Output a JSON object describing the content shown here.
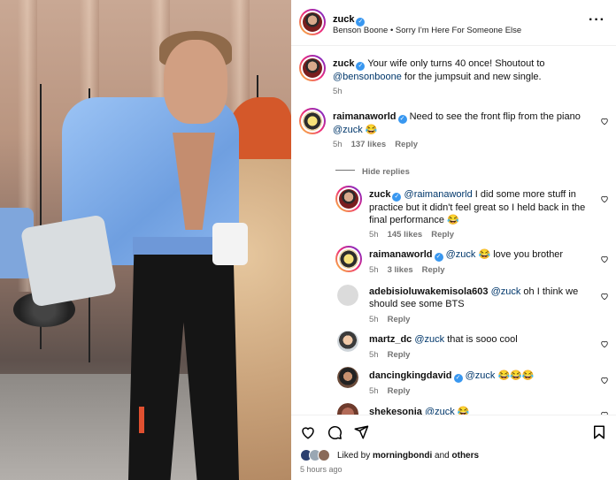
{
  "post": {
    "author": "zuck",
    "subtitle": "Benson Boone • Sorry I'm Here For Someone Else",
    "more_icon": "more-horizontal-icon"
  },
  "caption": {
    "username": "zuck",
    "text_before": "Your wife only turns 40 once! Shoutout to ",
    "mention": "@bensonboone",
    "text_after": " for the jumpsuit and new single.",
    "time": "5h"
  },
  "comments": [
    {
      "username": "raimanaworld",
      "verified": true,
      "text": "Need to see the front flip from the piano ",
      "mention": "@zuck",
      "emoji": "😂",
      "time": "5h",
      "likes": "137 likes",
      "reply": "Reply"
    },
    {
      "hide_replies": "Hide replies"
    },
    {
      "username": "zuck",
      "verified": true,
      "mention": "@raimanaworld",
      "text": " I did some more stuff in practice but it didn't feel great so I held back in the final performance ",
      "emoji": "😂",
      "time": "5h",
      "likes": "145 likes",
      "reply": "Reply"
    },
    {
      "username": "raimanaworld",
      "verified": true,
      "mention": "@zuck",
      "text": " ",
      "emoji": "😂",
      "text_after": " love you brother",
      "time": "5h",
      "likes": "3 likes",
      "reply": "Reply"
    },
    {
      "username": "adebisioluwakemisola603",
      "verified": false,
      "mention": "@zuck",
      "text": " oh I think we should see some BTS",
      "time": "5h",
      "reply": "Reply"
    },
    {
      "username": "martz_dc",
      "verified": false,
      "mention": "@zuck",
      "text": " that is sooo cool",
      "time": "5h",
      "reply": "Reply"
    },
    {
      "username": "dancingkingdavid",
      "verified": true,
      "mention": "@zuck",
      "text": " ",
      "emoji": "😂😂😂",
      "time": "5h",
      "reply": "Reply"
    },
    {
      "username": "shekesonia",
      "verified": false,
      "mention": "@zuck",
      "text": " ",
      "emoji": "😂"
    }
  ],
  "footer": {
    "liked_by_prefix": "Liked by ",
    "liked_by_user": "morningbondi",
    "liked_by_and": " and ",
    "liked_by_others": "others",
    "posted_ago": "5 hours ago"
  },
  "colors": {
    "mention": "#00376b",
    "verified": "#3897f0",
    "meta": "#737373"
  }
}
